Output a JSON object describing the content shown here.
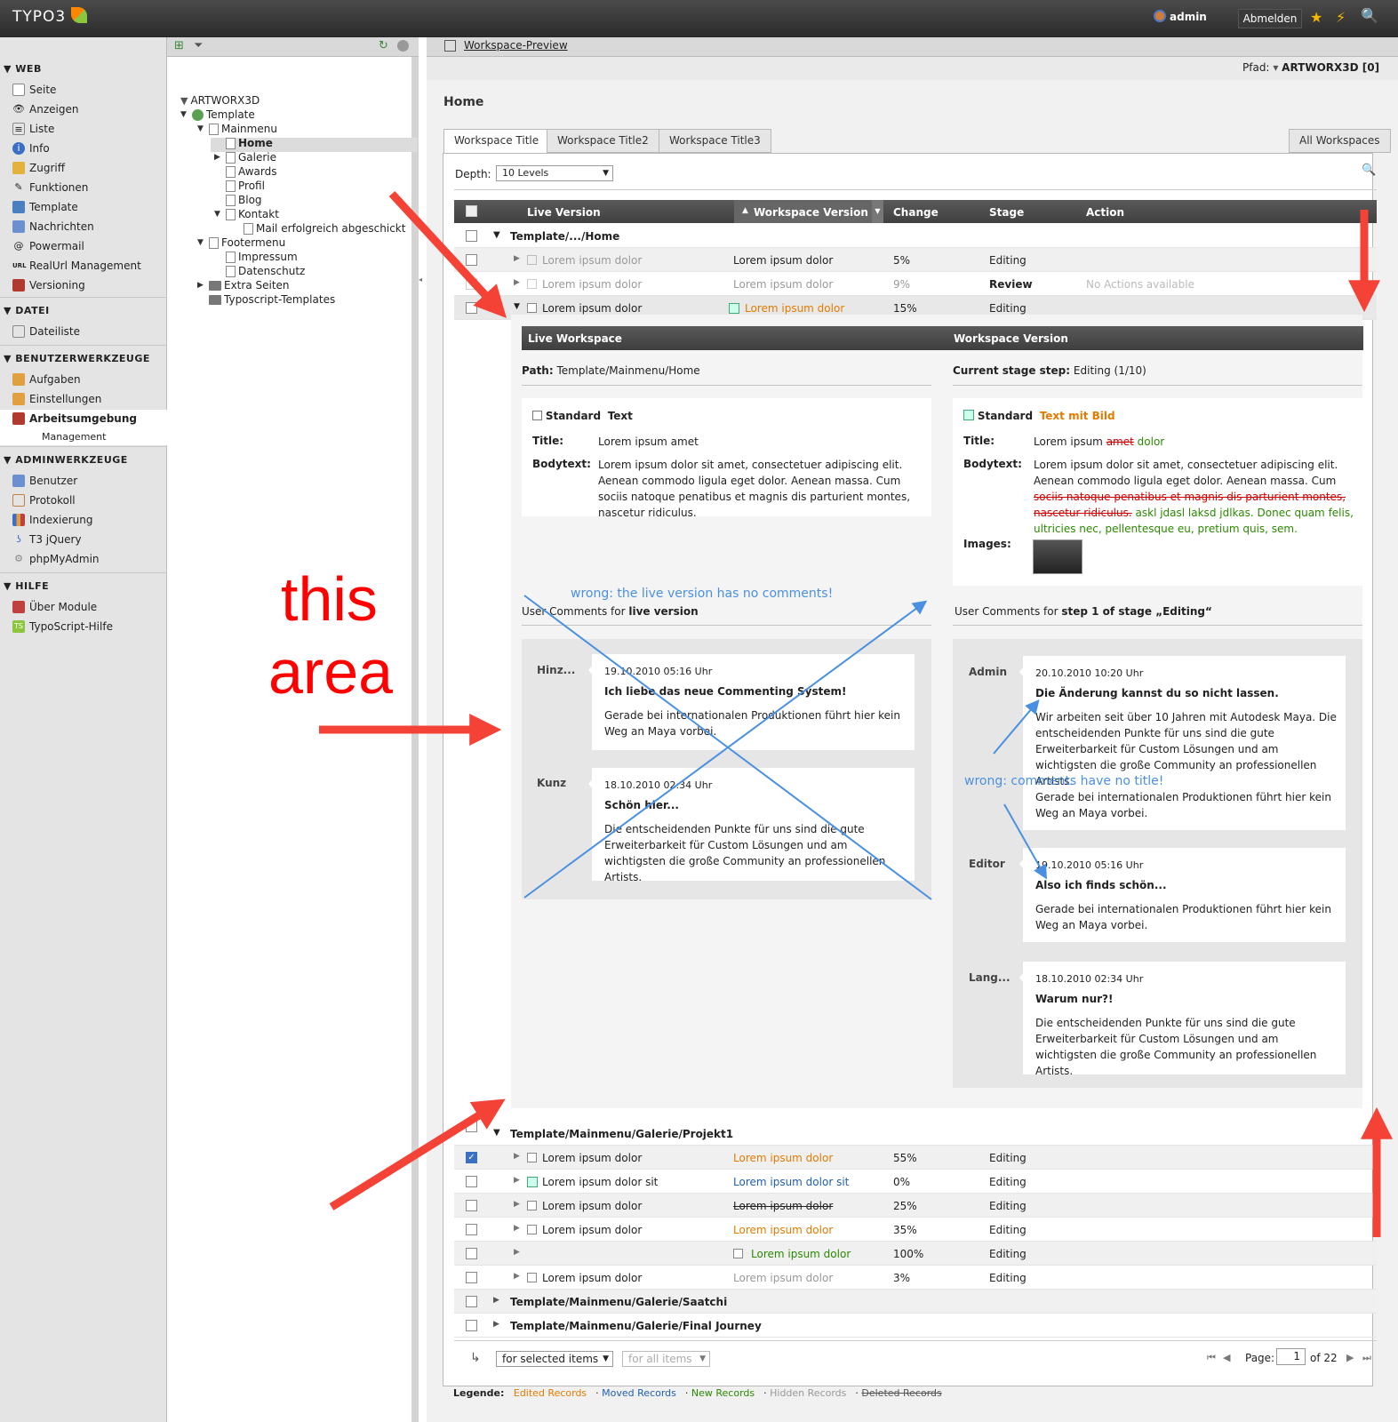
{
  "app": {
    "logo": "TYPO3",
    "user": "admin",
    "logout": "Abmelden"
  },
  "modmenu": {
    "web": {
      "head": "WEB",
      "items": [
        "Seite",
        "Anzeigen",
        "Liste",
        "Info",
        "Zugriff",
        "Funktionen",
        "Template",
        "Nachrichten",
        "Powermail",
        "RealUrl Management",
        "Versioning"
      ]
    },
    "datei": {
      "head": "DATEI",
      "items": [
        "Dateiliste"
      ]
    },
    "benutzer": {
      "head": "BENUTZERWERKZEUGE",
      "items": [
        "Aufgaben",
        "Einstellungen",
        "Arbeitsumgebung",
        "Management"
      ]
    },
    "admin": {
      "head": "ADMINWERKZEUGE",
      "items": [
        "Benutzer",
        "Protokoll",
        "Indexierung",
        "T3 jQuery",
        "phpMyAdmin"
      ]
    },
    "hilfe": {
      "head": "HILFE",
      "items": [
        "Über Module",
        "TypoScript-Hilfe"
      ]
    }
  },
  "tree": [
    "ARTWORX3D",
    "Template",
    "Mainmenu",
    "Home",
    "Galerie",
    "Awards",
    "Profil",
    "Blog",
    "Kontakt",
    "Mail erfolgreich abgeschickt",
    "Footermenu",
    "Impressum",
    "Datenschutz",
    "Extra Seiten",
    "Typoscript-Templates"
  ],
  "doc": {
    "title": "Workspace-Preview",
    "path_label": "Pfad:",
    "path_value": "ARTWORX3D [0]",
    "page_title": "Home"
  },
  "tabs": [
    "Workspace Title",
    "Workspace Title2",
    "Workspace Title3"
  ],
  "all_workspaces": "All Workspaces",
  "depth": {
    "label": "Depth:",
    "value": "10 Levels"
  },
  "grid": {
    "headers": [
      "Live Version",
      "Workspace Version",
      "Change",
      "Stage",
      "Action"
    ],
    "group1": "Template/.../Home",
    "rows1": [
      {
        "live": "Lorem ipsum dolor",
        "ws": "Lorem ipsum dolor",
        "change": "5%",
        "stage": "Editing",
        "action": ""
      },
      {
        "live": "Lorem ipsum dolor",
        "ws": "Lorem ipsum dolor",
        "change": "9%",
        "stage": "Review",
        "action": "No Actions available"
      },
      {
        "live": "Lorem ipsum dolor",
        "ws": "Lorem ipsum dolor",
        "change": "15%",
        "stage": "Editing",
        "action": ""
      }
    ],
    "group2": "Template/Mainmenu/Galerie/Projekt1",
    "rows2": [
      {
        "live": "Lorem ipsum dolor",
        "ws": "Lorem ipsum dolor",
        "change": "55%",
        "stage": "Editing"
      },
      {
        "live": "Lorem ipsum dolor sit",
        "ws": "Lorem ipsum dolor sit",
        "change": "0%",
        "stage": "Editing"
      },
      {
        "live": "Lorem ipsum dolor",
        "ws": "Lorem ipsum dolor",
        "change": "25%",
        "stage": "Editing"
      },
      {
        "live": "Lorem ipsum dolor",
        "ws": "Lorem ipsum dolor",
        "change": "35%",
        "stage": "Editing"
      },
      {
        "live": "",
        "ws": "Lorem ipsum dolor",
        "change": "100%",
        "stage": "Editing"
      },
      {
        "live": "Lorem ipsum dolor",
        "ws": "Lorem ipsum dolor",
        "change": "3%",
        "stage": "Editing"
      }
    ],
    "group3": "Template/Mainmenu/Galerie/Saatchi",
    "group4": "Template/Mainmenu/Galerie/Final Journey"
  },
  "detail": {
    "live_head": "Live Workspace",
    "ws_head": "Workspace Version",
    "path_label": "Path:",
    "path_value": "Template/Mainmenu/Home",
    "stage_label": "Current stage step:",
    "stage_value": "Editing (1/10)",
    "live_type": "Standard",
    "live_ctype": "Text",
    "ws_type": "Standard",
    "ws_ctype": "Text mit Bild",
    "title_label": "Title:",
    "body_label": "Bodytext:",
    "images_label": "Images:",
    "live_title": "Lorem ipsum amet",
    "live_body": "Lorem ipsum dolor sit amet, consectetuer adipiscing elit. Aenean commodo ligula eget dolor. Aenean massa. Cum sociis natoque penatibus et magnis dis parturient montes, nascetur ridiculus.",
    "ws_title_a": "Lorem ipsum",
    "ws_title_del": "amet",
    "ws_title_add": "dolor",
    "ws_body_a": "Lorem ipsum dolor sit amet, consectetuer adipiscing elit. Aenean commodo ligula eget dolor. Aenean massa. Cum",
    "ws_body_del": "sociis natoque penatibus et magnis dis parturient montes, nascetur ridiculus.",
    "ws_body_add": "askl jdasl laksd jdlkas. Donec quam felis, ultricies nec, pellentesque eu, pretium quis, sem.",
    "live_comments_label": "User Comments for",
    "live_comments_strong": "live version",
    "ws_comments_label": "User Comments for",
    "ws_comments_strong": "step 1 of stage „Editing“",
    "live_comments": [
      {
        "author": "Hinz...",
        "date": "19.10.2010 05:16 Uhr",
        "title": "Ich liebe das neue Commenting System!",
        "body": "Gerade bei internationalen Produktionen führt hier kein Weg an Maya vorbei."
      },
      {
        "author": "Kunz",
        "date": "18.10.2010 02:34 Uhr",
        "title": "Schön hier...",
        "body": "Die entscheidenden Punkte für uns sind die gute Erweiterbarkeit für Custom Lösungen und am wichtigsten die große Community an professionellen Artists."
      }
    ],
    "ws_comments": [
      {
        "author": "Admin",
        "date": "20.10.2010 10:20 Uhr",
        "title": "Die Änderung kannst du so nicht lassen.",
        "body": "Wir arbeiten seit über 10 Jahren mit Autodesk Maya. Die entscheidenden Punkte für uns sind die gute Erweiterbarkeit für Custom Lösungen und am wichtigsten die große Community an professionellen Artists.",
        "body2": "Gerade bei internationalen Produktionen führt hier kein Weg an Maya vorbei."
      },
      {
        "author": "Editor",
        "date": "19.10.2010 05:16 Uhr",
        "title": "Also ich finds schön...",
        "body": "Gerade bei internationalen Produktionen führt hier kein Weg an Maya vorbei."
      },
      {
        "author": "Lang...",
        "date": "18.10.2010 02:34 Uhr",
        "title": "Warum nur?!",
        "body": "Die entscheidenden Punkte für uns sind die gute Erweiterbarkeit für Custom Lösungen und am wichtigsten die große Community an professionellen Artists."
      }
    ]
  },
  "annotations": {
    "wrong1": "wrong: the live version has no comments!",
    "wrong2": "wrong: comments have no title!",
    "this": "this",
    "area": "area"
  },
  "footer": {
    "sel1": "for selected items",
    "sel2": "for all items",
    "page_label": "Page:",
    "page_value": "1",
    "of": "of 22"
  },
  "legend": {
    "label": "Legende:",
    "edited": "Edited Records",
    "moved": "Moved Records",
    "new": "New Records",
    "hidden": "Hidden Records",
    "deleted": "Deleted Records"
  },
  "colors": {
    "orange": "#e47b00",
    "blue": "#1f5fb0",
    "green": "#2a8a00",
    "annot_red": "#f44336",
    "annot_blue": "#4a90e2"
  }
}
